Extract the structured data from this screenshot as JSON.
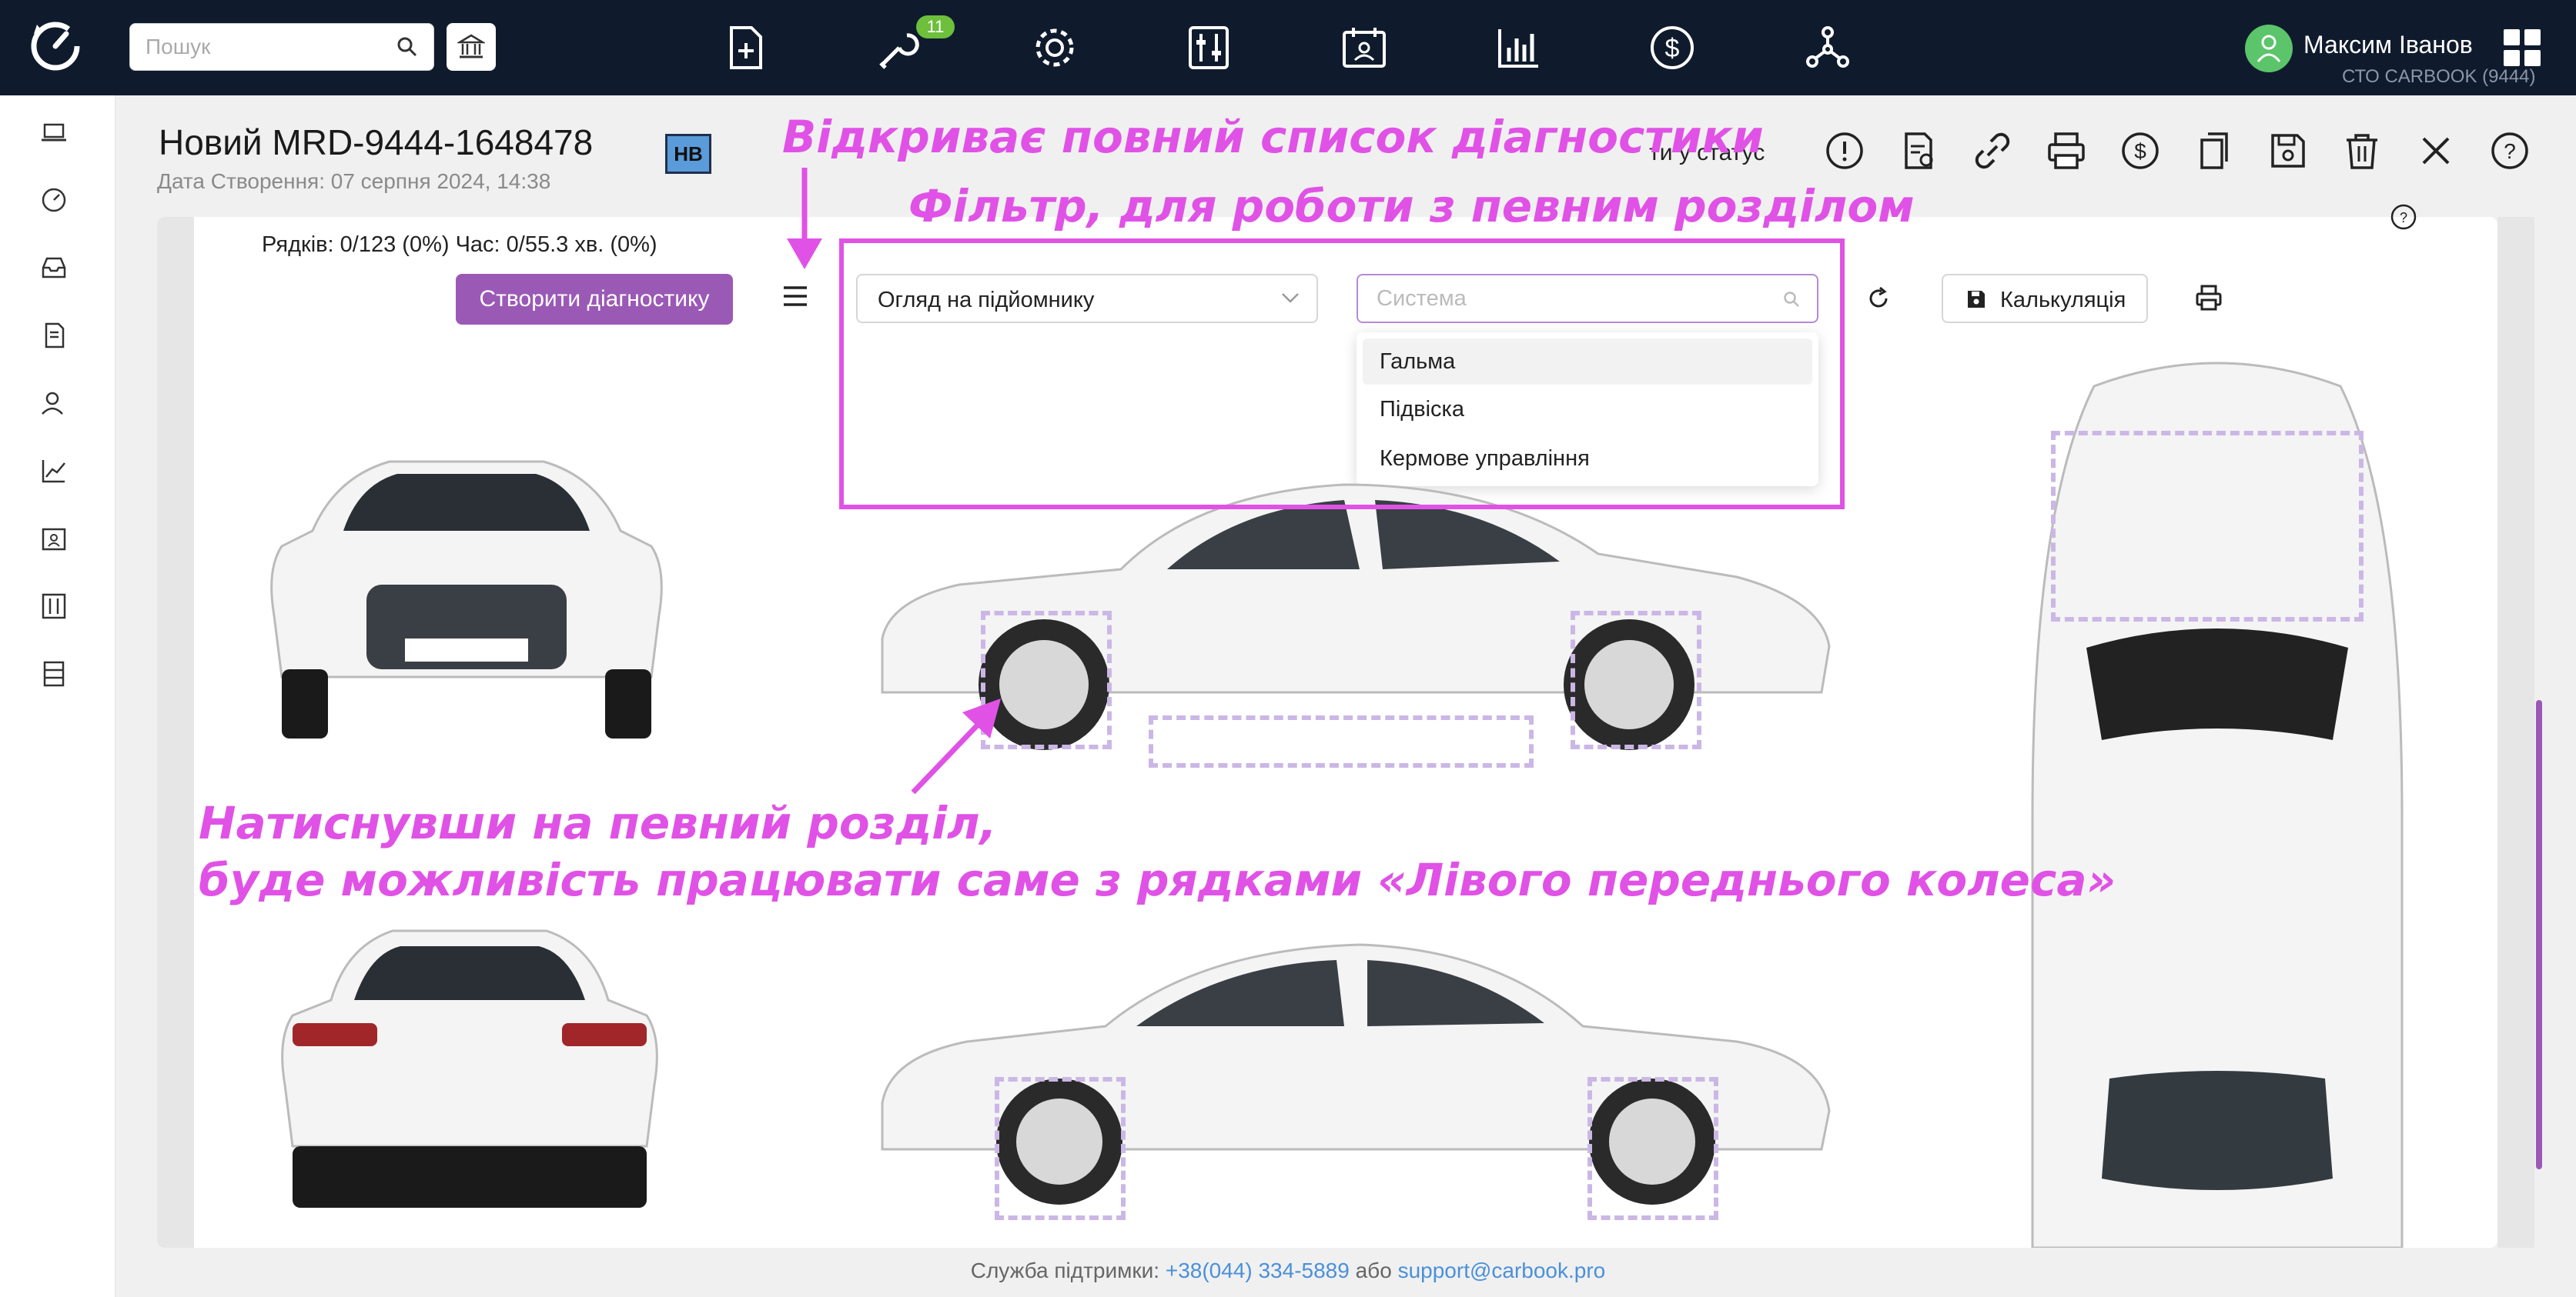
{
  "topbar": {
    "search_placeholder": "Пошук",
    "badge_count": "11",
    "user_name": "Максим Іванов",
    "user_org": "СТО CARBOOK (9444)"
  },
  "header": {
    "title": "Новий MRD-9444-1648478",
    "created": "Дата Створення: 07 серпня 2024, 14:38",
    "badge": "НВ",
    "status_text": "ти у статус"
  },
  "toolbar": {
    "rows_info": "Рядків: 0/123 (0%) Час: 0/55.3 хв. (0%)",
    "create_label": "Створити діагностику",
    "select_value": "Огляд на підйомнику",
    "system_placeholder": "Система",
    "calc_label": "Калькуляція"
  },
  "dropdown": {
    "items": [
      "Гальма",
      "Підвіска",
      "Кермове управління"
    ]
  },
  "annotations": {
    "list_hint": "Відкриває повний список діагностики",
    "filter_hint": "Фільтр, для роботи з певним розділом",
    "section_hint_1": "Натиснувши на певний розділ,",
    "section_hint_2": "буде можливість працювати саме з рядками «Лівого переднього колеса»"
  },
  "footer": {
    "prefix": "Служба підтримки: ",
    "phone": "+38(044) 334-5889",
    "or": " або ",
    "email": "support@carbook.pro"
  },
  "colors": {
    "topbar": "#0f1b2d",
    "accent": "#9b59b6",
    "annotation": "#e052e6",
    "link": "#4a90d9"
  }
}
